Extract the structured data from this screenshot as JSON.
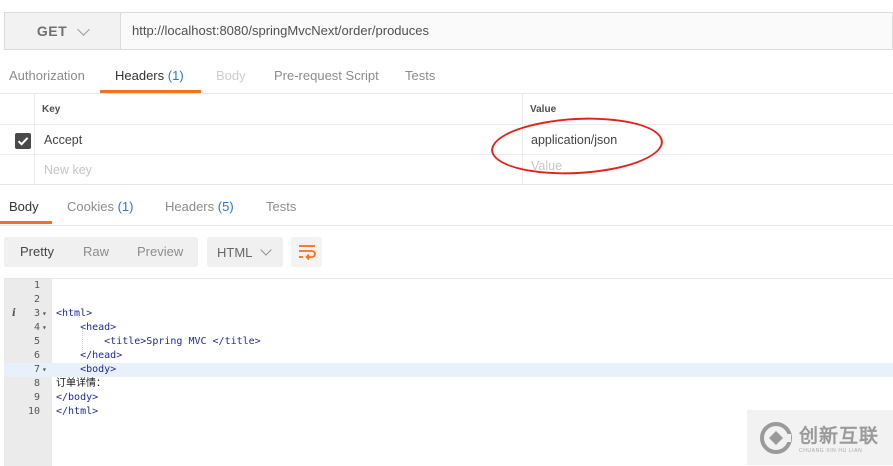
{
  "request": {
    "method": "GET",
    "url": "http://localhost:8080/springMvcNext/order/produces"
  },
  "request_tabs": [
    {
      "label": "Authorization",
      "count": ""
    },
    {
      "label": "Headers",
      "count": "(1)"
    },
    {
      "label": "Body",
      "count": ""
    },
    {
      "label": "Pre-request Script",
      "count": ""
    },
    {
      "label": "Tests",
      "count": ""
    }
  ],
  "headers_table": {
    "key_header": "Key",
    "value_header": "Value",
    "rows": [
      {
        "checked": true,
        "key": "Accept",
        "value": "application/json"
      }
    ],
    "new_key_placeholder": "New key",
    "new_value_placeholder": "Value"
  },
  "response_tabs": [
    {
      "label": "Body",
      "count": ""
    },
    {
      "label": "Cookies",
      "count": "(1)"
    },
    {
      "label": "Headers",
      "count": "(5)"
    },
    {
      "label": "Tests",
      "count": ""
    }
  ],
  "view_modes": [
    "Pretty",
    "Raw",
    "Preview"
  ],
  "format": "HTML",
  "code_lines": [
    {
      "num": "1",
      "text": ""
    },
    {
      "num": "2",
      "text": ""
    },
    {
      "num": "3",
      "text": "<html>"
    },
    {
      "num": "4",
      "text": "    <head>"
    },
    {
      "num": "5",
      "text": "        <title>Spring MVC </title>"
    },
    {
      "num": "6",
      "text": "    </head>"
    },
    {
      "num": "7",
      "text": "    <body>"
    },
    {
      "num": "8",
      "text": "订单详情："
    },
    {
      "num": "9",
      "text": "</body>"
    },
    {
      "num": "10",
      "text": "</html>"
    }
  ],
  "watermark": {
    "text": "创新互联",
    "subtext": "CHUANG XIN HU LIAN"
  },
  "colors": {
    "accent": "#f47023",
    "count": "#2a78c7",
    "highlight_ellipse": "#e2231a"
  }
}
